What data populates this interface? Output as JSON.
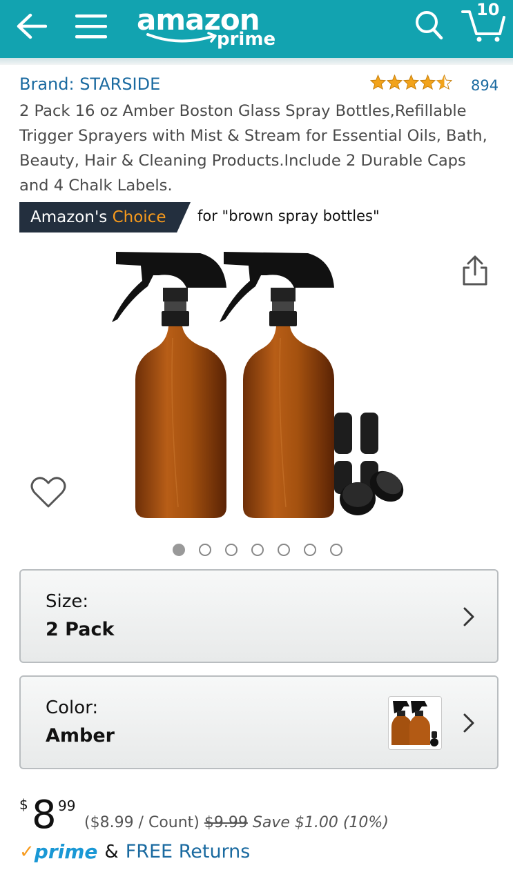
{
  "header": {
    "logo_main": "amazon",
    "logo_sub": "prime",
    "cart_count": "10",
    "bg_color": "#12a3b0"
  },
  "product": {
    "brand": "Brand: STARSIDE",
    "rating": 4.5,
    "rating_count": "894",
    "title": "2 Pack 16 oz Amber Boston Glass Spray Bottles,Refillable Trigger Sprayers with Mist & Stream for Essential Oils, Bath, Beauty, Hair & Cleaning Products.Include 2 Durable Caps and 4 Chalk Labels.",
    "choice_prefix": "Amazon's",
    "choice_highlight": "Choice",
    "choice_for": "for \"brown spray bottles\""
  },
  "gallery": {
    "image_count": 7,
    "active_index": 0
  },
  "variations": {
    "size_label": "Size:",
    "size_value": "2 Pack",
    "color_label": "Color:",
    "color_value": "Amber"
  },
  "price": {
    "currency": "$",
    "whole": "8",
    "fraction": "99",
    "per_unit": "($8.99 / Count)",
    "list_price": "$9.99",
    "savings": "Save $1.00 (10%)"
  },
  "shipping": {
    "prime_label": "prime",
    "amp": "&",
    "returns": "FREE Returns"
  },
  "icons": {
    "back": "back-arrow-icon",
    "menu": "hamburger-menu-icon",
    "search": "search-icon",
    "cart": "cart-icon",
    "share": "share-icon",
    "wishlist": "heart-icon",
    "chevron": "chevron-right-icon"
  },
  "colors": {
    "link": "#1a6aa0",
    "star": "#f2a31b",
    "badge_bg": "#232f3e",
    "badge_accent": "#f79a1c"
  }
}
